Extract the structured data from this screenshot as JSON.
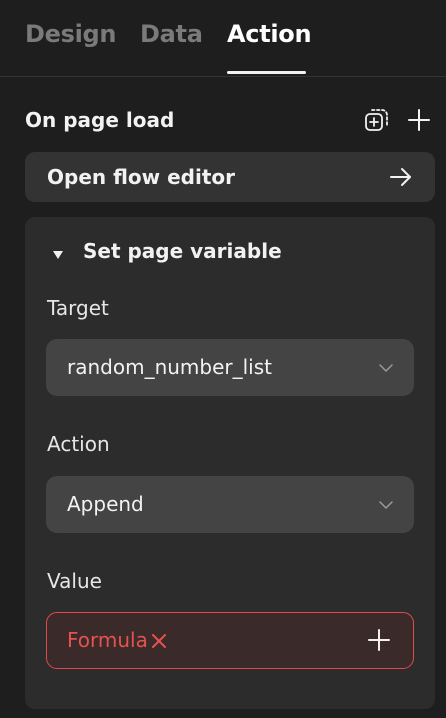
{
  "tabs": [
    {
      "label": "Design",
      "active": false
    },
    {
      "label": "Data",
      "active": false
    },
    {
      "label": "Action",
      "active": true
    }
  ],
  "section": {
    "title": "On page load",
    "icons": [
      "add-frame-icon",
      "plus-icon"
    ]
  },
  "flow_button": {
    "label": "Open flow editor",
    "icon": "arrow-right-icon"
  },
  "action_card": {
    "title": "Set page variable",
    "expanded": true,
    "fields": {
      "target": {
        "label": "Target",
        "value": "random_number_list"
      },
      "action": {
        "label": "Action",
        "value": "Append"
      },
      "value": {
        "label": "Value",
        "value": "Formula",
        "error": true
      }
    }
  },
  "colors": {
    "background": "#1e1e1e",
    "panel": "#2c2c2c",
    "input": "#444444",
    "error": "#e14a4a",
    "text": "#f2f2f2",
    "tab_inactive": "#7a7a7a"
  }
}
